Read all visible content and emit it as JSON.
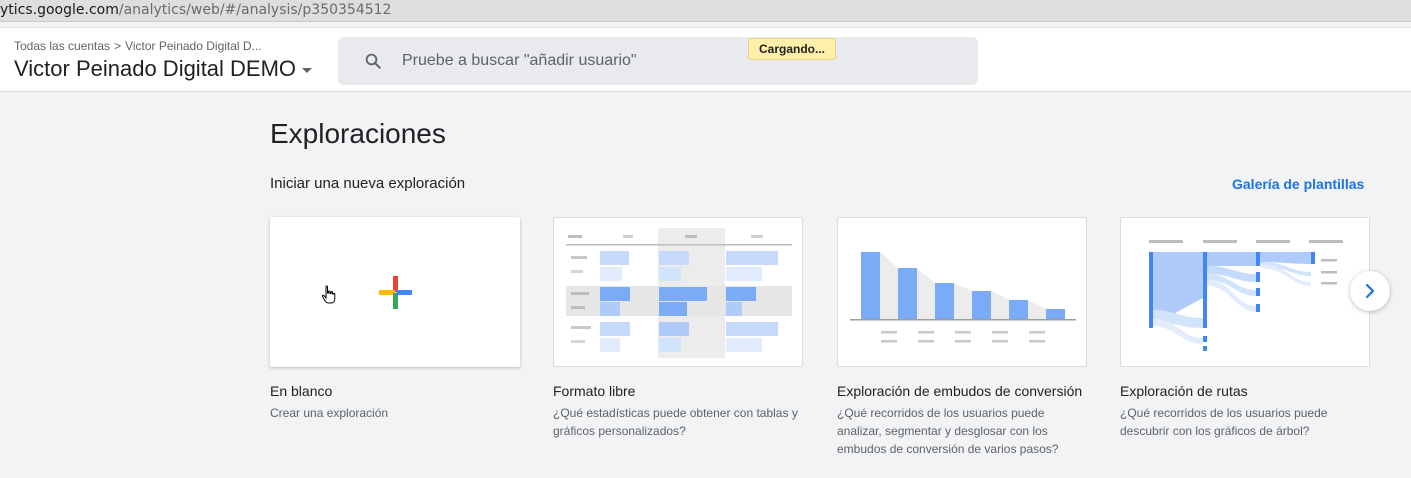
{
  "browser": {
    "url_host": "ytics.google.com",
    "url_path": "/analytics/web/#/analysis/p350354512"
  },
  "header": {
    "breadcrumb_root": "Todas las cuentas",
    "breadcrumb_separator": ">",
    "breadcrumb_account": "Victor Peinado Digital D...",
    "account_name": "Victor Peinado Digital DEMO",
    "search_placeholder": "Pruebe a buscar \"añadir usuario\"",
    "loading_badge": "Cargando..."
  },
  "main": {
    "title": "Exploraciones",
    "subtitle": "Iniciar una nueva exploración",
    "gallery_link": "Galería de plantillas",
    "templates": [
      {
        "title": "En blanco",
        "description": "Crear una exploración"
      },
      {
        "title": "Formato libre",
        "description": "¿Qué estadísticas puede obtener con tablas y gráficos personalizados?"
      },
      {
        "title": "Exploración de embudos de conversión",
        "description": "¿Qué recorridos de los usuarios puede analizar, segmentar y desglosar con los embudos de conversión de varios pasos?"
      },
      {
        "title": "Exploración de rutas",
        "description": "¿Qué recorridos de los usuarios puede descubrir con los gráficos de árbol?"
      }
    ]
  },
  "icons": {
    "search": "search-icon",
    "plus": "google-plus-icon",
    "next": "chevron-right-icon",
    "cursor": "hand-pointer-icon"
  },
  "colors": {
    "accent_blue": "#1a73e8",
    "bar_blue": "#7baaf7",
    "light_blue": "#d2e3fc",
    "google_red": "#ea4335",
    "google_yellow": "#fbbc04",
    "google_green": "#34a853",
    "google_blue": "#4285f4"
  }
}
